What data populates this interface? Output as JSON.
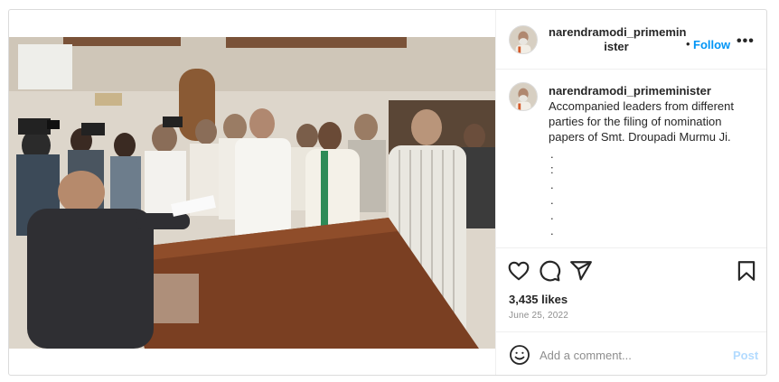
{
  "post": {
    "username": "narendramodi_primeminister",
    "header_username_line1": "narendramodi_primemin",
    "header_username_line2": "ister",
    "separator": "•",
    "follow_label": "Follow",
    "more_label": "•••",
    "caption_lines": [
      "Accompanied leaders from different",
      "parties for the filing of nomination",
      "papers of Smt. Droupadi Murmu Ji."
    ],
    "caption_dots": [
      ".",
      ":",
      ".",
      ".",
      ".",
      ".",
      "."
    ],
    "likes": "3,435 likes",
    "date": "June 25, 2022",
    "comment_placeholder": "Add a comment...",
    "post_label": "Post",
    "icons": {
      "like": "heart-icon",
      "comment": "comment-icon",
      "share": "share-icon",
      "save": "bookmark-icon",
      "emoji": "emoji-icon",
      "more": "more-options-icon"
    },
    "colors": {
      "follow": "#0095f6",
      "post_disabled": "#b3dbff",
      "muted": "#8e8e8e",
      "border": "#dbdbdb"
    }
  }
}
